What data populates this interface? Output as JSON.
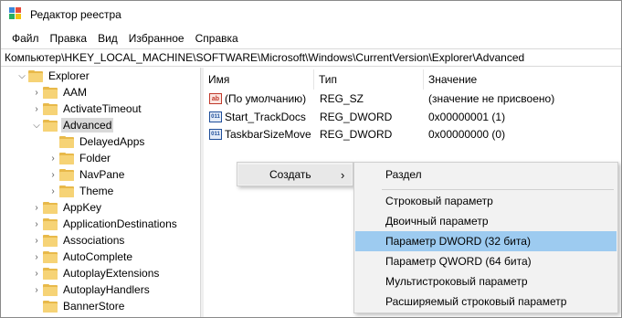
{
  "window": {
    "title": "Редактор реестра"
  },
  "menu": [
    "Файл",
    "Правка",
    "Вид",
    "Избранное",
    "Справка"
  ],
  "address": "Компьютер\\HKEY_LOCAL_MACHINE\\SOFTWARE\\Microsoft\\Windows\\CurrentVersion\\Explorer\\Advanced",
  "tree": {
    "items": [
      {
        "label": "Explorer",
        "expanded": true
      },
      {
        "label": "AAM",
        "expanded": false
      },
      {
        "label": "ActivateTimeout",
        "expanded": false
      },
      {
        "label": "Advanced",
        "expanded": true,
        "selected": true
      },
      {
        "label": "DelayedApps"
      },
      {
        "label": "Folder",
        "expanded": false
      },
      {
        "label": "NavPane",
        "expanded": false
      },
      {
        "label": "Theme",
        "expanded": false
      },
      {
        "label": "AppKey",
        "expanded": false
      },
      {
        "label": "ApplicationDestinations",
        "expanded": false
      },
      {
        "label": "Associations",
        "expanded": false
      },
      {
        "label": "AutoComplete",
        "expanded": false
      },
      {
        "label": "AutoplayExtensions",
        "expanded": false
      },
      {
        "label": "AutoplayHandlers",
        "expanded": false
      },
      {
        "label": "BannerStore"
      }
    ]
  },
  "columns": {
    "name": "Имя",
    "type": "Тип",
    "value": "Значение"
  },
  "values": [
    {
      "name": "(По умолчанию)",
      "type": "REG_SZ",
      "data": "(значение не присвоено)",
      "icon": "ab"
    },
    {
      "name": "Start_TrackDocs",
      "type": "REG_DWORD",
      "data": "0x00000001 (1)",
      "icon": "011"
    },
    {
      "name": "TaskbarSizeMove",
      "type": "REG_DWORD",
      "data": "0x00000000 (0)",
      "icon": "011"
    }
  ],
  "context_menu": {
    "item": "Создать",
    "arrow": "›"
  },
  "submenu": {
    "items": [
      "Раздел",
      "Строковый параметр",
      "Двоичный параметр",
      "Параметр DWORD (32 бита)",
      "Параметр QWORD (64 бита)",
      "Мультистроковый параметр",
      "Расширяемый строковый параметр"
    ],
    "highlighted": "Параметр DWORD (32 бита)"
  },
  "colors": {
    "highlight": "#9dcbf0",
    "selected": "#d9d9d9",
    "folder": "#f6d376"
  }
}
